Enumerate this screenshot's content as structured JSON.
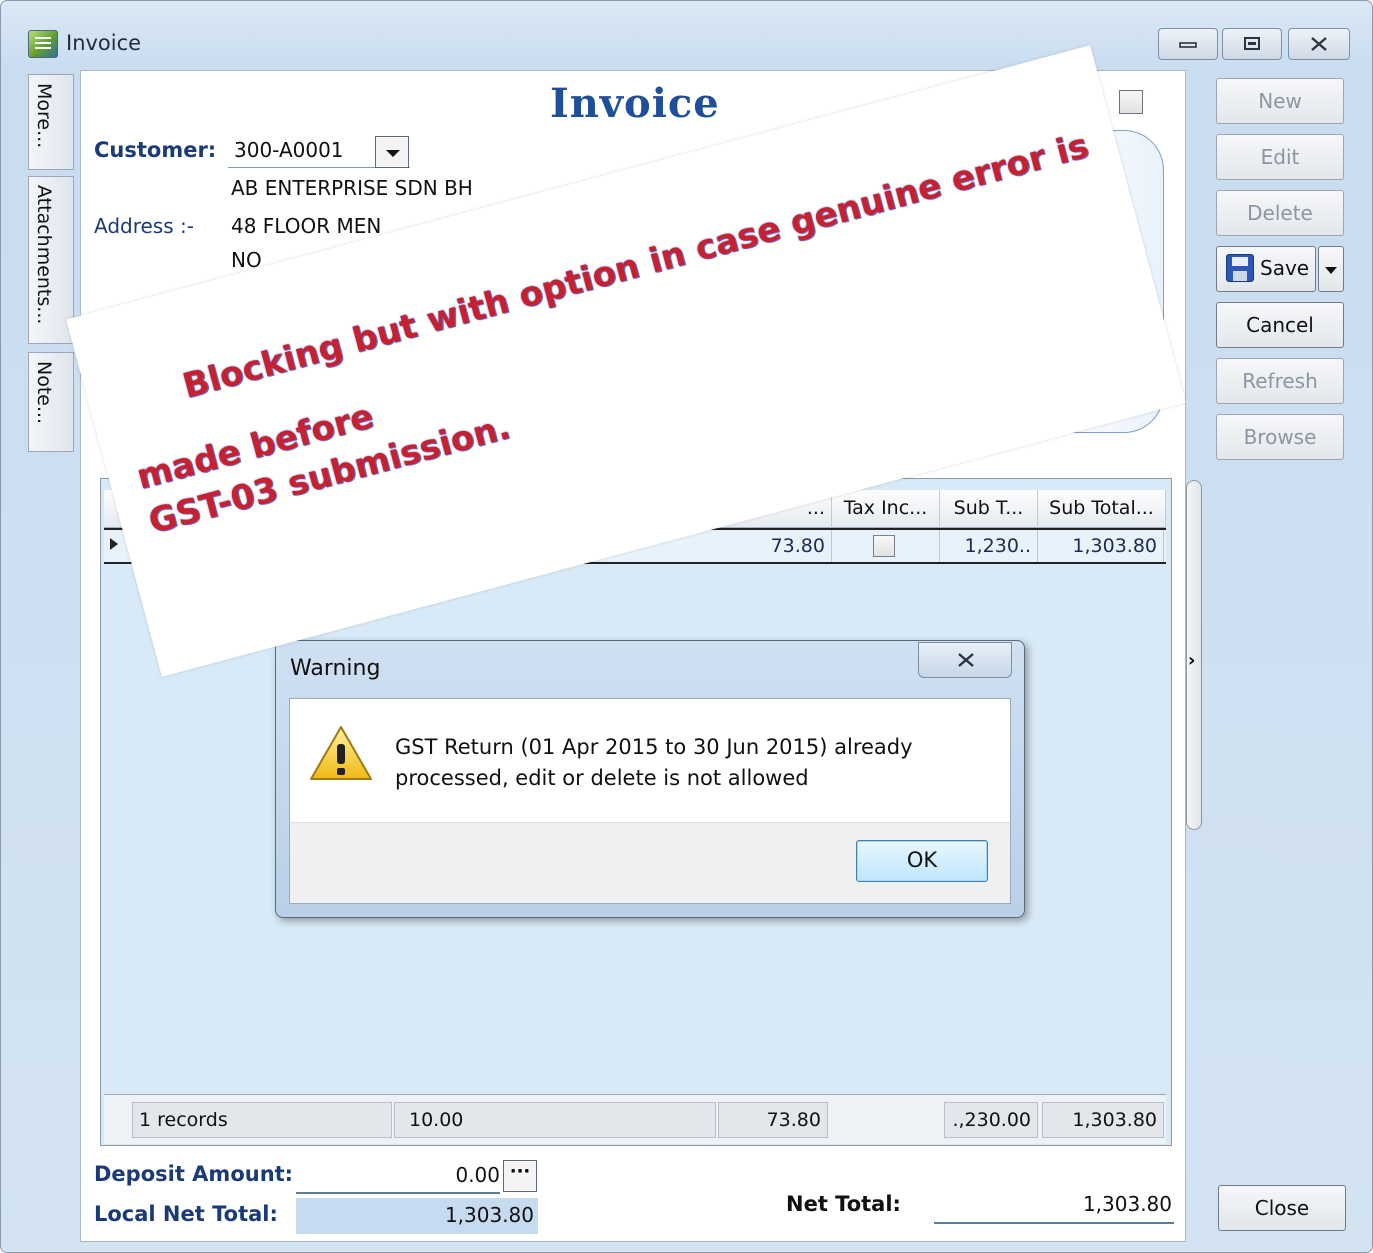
{
  "window": {
    "title": "Invoice"
  },
  "side_tabs": [
    "More...",
    "Attachments...",
    "Note..."
  ],
  "form": {
    "heading": "Invoice",
    "customer_label": "Customer:",
    "customer_code": "300-A0001",
    "customer_name": "AB ENTERPRISE SDN BH",
    "address_label": "Address :-",
    "address_line1": "48 FLOOR MEN",
    "address_line2": "NO"
  },
  "grid": {
    "columns": [
      "...",
      "Tax Inc...",
      "Sub T...",
      "Sub Total..."
    ],
    "row": {
      "tax": "73.80",
      "tax_inclusive": false,
      "sub_total": "1,230..",
      "sub_total_tax": "1,303.80"
    },
    "footer": {
      "records": "1 records",
      "qty": "10.00",
      "tax": "73.80",
      "sub_total": ".,230.00",
      "sub_total_tax": "1,303.80"
    }
  },
  "toolbar": {
    "new": "New",
    "edit": "Edit",
    "delete": "Delete",
    "save": "Save",
    "cancel": "Cancel",
    "refresh": "Refresh",
    "browse": "Browse",
    "close": "Close"
  },
  "totals": {
    "deposit_label": "Deposit Amount:",
    "deposit_value": "0.00",
    "local_net_label": "Local Net Total:",
    "local_net_value": "1,303.80",
    "net_total_label": "Net Total:",
    "net_total_value": "1,303.80"
  },
  "dialog": {
    "title": "Warning",
    "message": "GST Return (01 Apr 2015 to 30 Jun 2015) already processed, edit or delete is not allowed",
    "ok": "OK"
  },
  "annotation": {
    "line1": "Blocking but with option in case genuine error is",
    "line2": "made before",
    "line3": "GST-03 submission."
  },
  "colors": {
    "accent_text": "#1a3a7a",
    "annotation": "#c8202c",
    "heading": "#1f4e9a"
  },
  "icons": [
    "app-icon",
    "minimize-icon",
    "maximize-icon",
    "close-icon",
    "dropdown-arrow-icon",
    "floppy-save-icon",
    "warning-icon",
    "row-pointer-icon"
  ]
}
